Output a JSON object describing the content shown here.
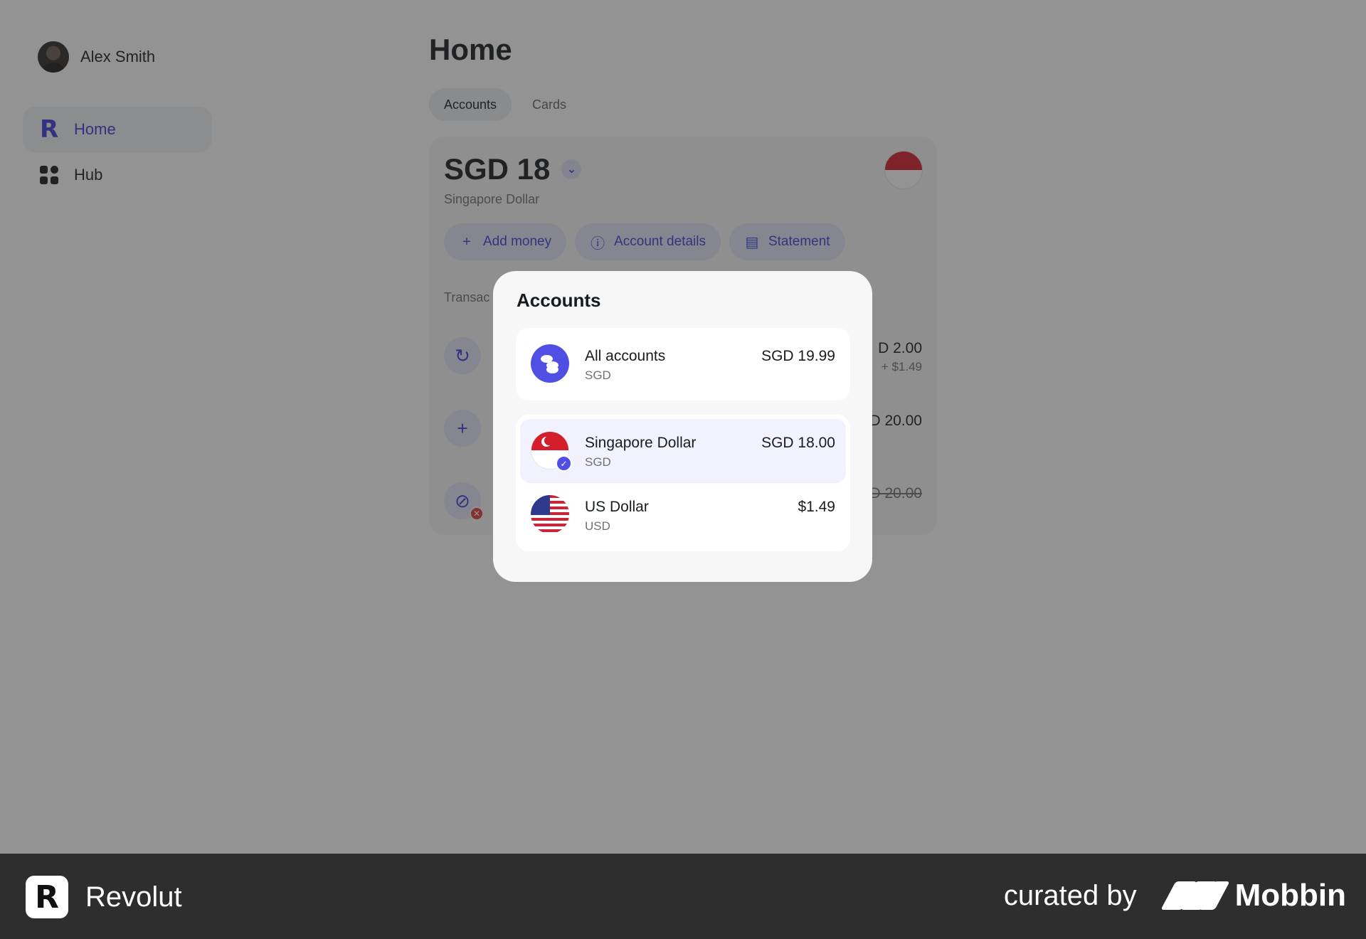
{
  "user": {
    "name": "Alex Smith"
  },
  "sidebar": {
    "items": [
      {
        "label": "Home",
        "icon": "revolut-r-icon",
        "active": true
      },
      {
        "label": "Hub",
        "icon": "grid-icon",
        "active": false
      }
    ]
  },
  "main": {
    "title": "Home",
    "tabs": [
      {
        "label": "Accounts",
        "active": true
      },
      {
        "label": "Cards",
        "active": false
      }
    ],
    "account": {
      "balance": "SGD 18",
      "currency_name": "Singapore Dollar",
      "actions": [
        {
          "label": "Add money",
          "icon": "plus-icon"
        },
        {
          "label": "Account details",
          "icon": "info-icon"
        },
        {
          "label": "Statement",
          "icon": "document-icon"
        }
      ],
      "transactions_heading": "Transac",
      "transactions": [
        {
          "icon": "exchange-icon",
          "amount": "D 2.00",
          "sub": "+ $1.49"
        },
        {
          "icon": "plus-icon",
          "amount": "D 20.00",
          "sub": ""
        },
        {
          "icon": "blocked-icon",
          "amount": "D 20.00",
          "sub": "",
          "declined": true
        }
      ]
    }
  },
  "modal": {
    "title": "Accounts",
    "all_accounts": {
      "name": "All accounts",
      "code": "SGD",
      "amount": "SGD 19.99",
      "icon": "coins-icon"
    },
    "accounts": [
      {
        "name": "Singapore Dollar",
        "code": "SGD",
        "amount": "SGD 18.00",
        "icon": "singapore-flag-icon",
        "selected": true
      },
      {
        "name": "US Dollar",
        "code": "USD",
        "amount": "$1.49",
        "icon": "us-flag-icon",
        "selected": false
      }
    ]
  },
  "footer": {
    "brand": "Revolut",
    "curated_by": "curated by",
    "curator": "Mobbin"
  },
  "colors": {
    "accent": "#3d3fd4",
    "accent_light": "#e4e5f9",
    "overlay": "rgba(40,40,40,0.5)",
    "footer_bg": "#2e2e2e",
    "flag_red": "#d41e2c"
  }
}
